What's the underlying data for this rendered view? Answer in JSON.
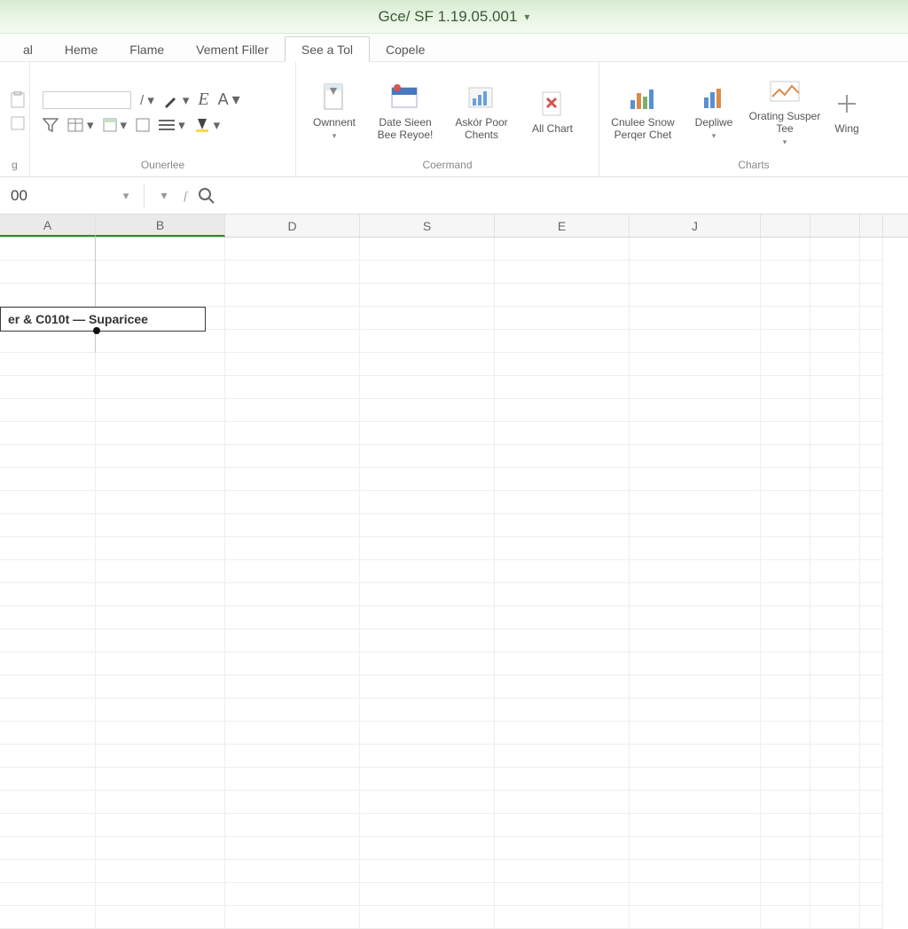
{
  "title": "Gce/ SF 1.19.05.001",
  "tabs": [
    {
      "label": "al"
    },
    {
      "label": "Heme"
    },
    {
      "label": "Flame"
    },
    {
      "label": "Vement Filler"
    },
    {
      "label": "See a Tol",
      "active": true
    },
    {
      "label": "Copele"
    }
  ],
  "ribbon": {
    "clipboard": {
      "label": "g"
    },
    "overview": {
      "label": "Ounerlee"
    },
    "command": {
      "label": "Coermand",
      "buttons": [
        {
          "id": "document",
          "label": "Ownnent",
          "icon": "doc",
          "dropdown": true
        },
        {
          "id": "datasheet",
          "label": "Date Sieen Bee Reyoe!",
          "icon": "datasheet"
        },
        {
          "id": "askpoor",
          "label": "Askór Poor Chents",
          "icon": "chartbox"
        },
        {
          "id": "allchart",
          "label": "All Chart",
          "icon": "xdoc"
        }
      ]
    },
    "charts": {
      "label": "Charts",
      "buttons": [
        {
          "id": "cruise",
          "label": "Cnulee Snow Perqer Chet",
          "icon": "barchart"
        },
        {
          "id": "dupl",
          "label": "Depliwe",
          "icon": "barsmall",
          "dropdown": true
        },
        {
          "id": "orating",
          "label": "Orating Susper Tee",
          "icon": "picture",
          "dropdown": true
        },
        {
          "id": "wing",
          "label": "Wing",
          "icon": "plus"
        }
      ]
    }
  },
  "formula_bar": {
    "name_box": "00"
  },
  "columns": [
    "A",
    "B",
    "D",
    "S",
    "E",
    "J",
    "",
    "",
    ""
  ],
  "col_classes": [
    "cA",
    "cB",
    "cD",
    "cS",
    "cE",
    "cJ",
    "cX",
    "cO",
    "cP"
  ],
  "selected_columns": [
    "A",
    "B"
  ],
  "cell_content": "er & C010t — Suparicee",
  "row_count": 30
}
